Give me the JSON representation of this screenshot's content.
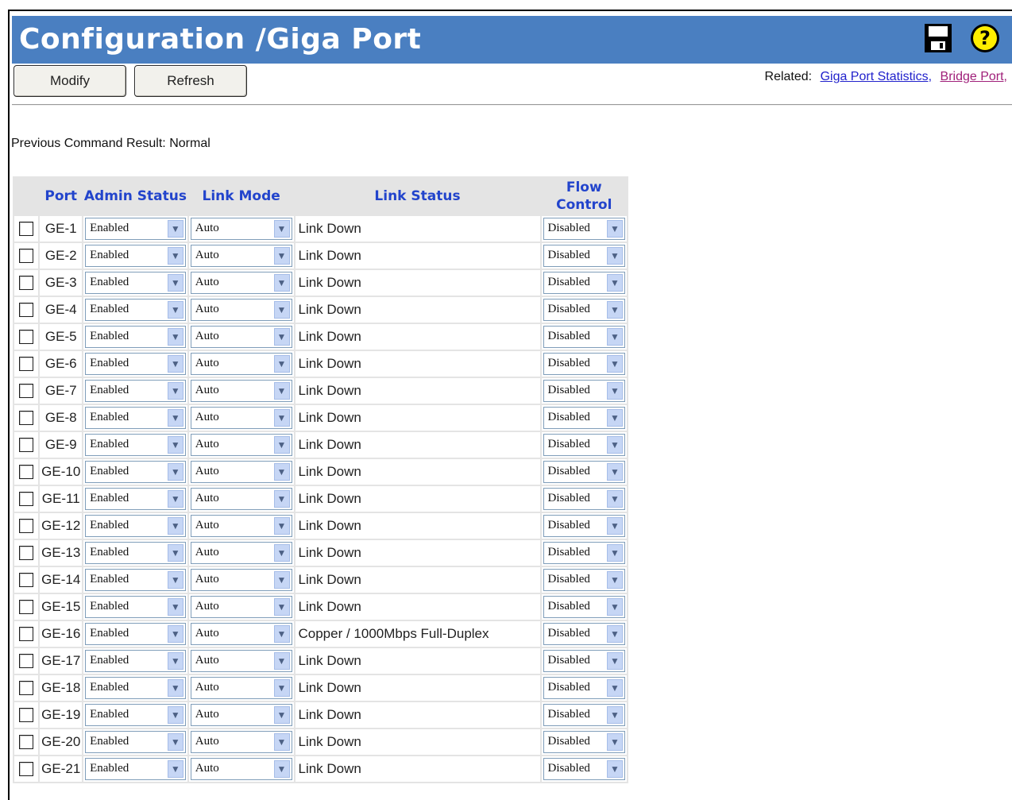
{
  "header": {
    "title": "Configuration /Giga Port",
    "save_icon": "floppy-save-icon",
    "help_icon": "help-question-icon",
    "help_glyph": "?"
  },
  "toolbar": {
    "modify_label": "Modify",
    "refresh_label": "Refresh"
  },
  "related": {
    "label": "Related:",
    "links": [
      "Giga Port Statistics,",
      "Bridge Port,"
    ]
  },
  "result": {
    "label": "Previous Command Result:",
    "value": "Normal"
  },
  "table": {
    "headers": {
      "port": "Port",
      "admin_status": "Admin Status",
      "link_mode": "Link Mode",
      "link_status": "Link Status",
      "flow_control": "Flow Control"
    },
    "rows": [
      {
        "port": "GE-1",
        "admin": "Enabled",
        "mode": "Auto",
        "status": "Link Down",
        "flow": "Disabled"
      },
      {
        "port": "GE-2",
        "admin": "Enabled",
        "mode": "Auto",
        "status": "Link Down",
        "flow": "Disabled"
      },
      {
        "port": "GE-3",
        "admin": "Enabled",
        "mode": "Auto",
        "status": "Link Down",
        "flow": "Disabled"
      },
      {
        "port": "GE-4",
        "admin": "Enabled",
        "mode": "Auto",
        "status": "Link Down",
        "flow": "Disabled"
      },
      {
        "port": "GE-5",
        "admin": "Enabled",
        "mode": "Auto",
        "status": "Link Down",
        "flow": "Disabled"
      },
      {
        "port": "GE-6",
        "admin": "Enabled",
        "mode": "Auto",
        "status": "Link Down",
        "flow": "Disabled"
      },
      {
        "port": "GE-7",
        "admin": "Enabled",
        "mode": "Auto",
        "status": "Link Down",
        "flow": "Disabled"
      },
      {
        "port": "GE-8",
        "admin": "Enabled",
        "mode": "Auto",
        "status": "Link Down",
        "flow": "Disabled"
      },
      {
        "port": "GE-9",
        "admin": "Enabled",
        "mode": "Auto",
        "status": "Link Down",
        "flow": "Disabled"
      },
      {
        "port": "GE-10",
        "admin": "Enabled",
        "mode": "Auto",
        "status": "Link Down",
        "flow": "Disabled"
      },
      {
        "port": "GE-11",
        "admin": "Enabled",
        "mode": "Auto",
        "status": "Link Down",
        "flow": "Disabled"
      },
      {
        "port": "GE-12",
        "admin": "Enabled",
        "mode": "Auto",
        "status": "Link Down",
        "flow": "Disabled"
      },
      {
        "port": "GE-13",
        "admin": "Enabled",
        "mode": "Auto",
        "status": "Link Down",
        "flow": "Disabled"
      },
      {
        "port": "GE-14",
        "admin": "Enabled",
        "mode": "Auto",
        "status": "Link Down",
        "flow": "Disabled"
      },
      {
        "port": "GE-15",
        "admin": "Enabled",
        "mode": "Auto",
        "status": "Link Down",
        "flow": "Disabled"
      },
      {
        "port": "GE-16",
        "admin": "Enabled",
        "mode": "Auto",
        "status": "Copper / 1000Mbps Full-Duplex",
        "flow": "Disabled"
      },
      {
        "port": "GE-17",
        "admin": "Enabled",
        "mode": "Auto",
        "status": "Link Down",
        "flow": "Disabled"
      },
      {
        "port": "GE-18",
        "admin": "Enabled",
        "mode": "Auto",
        "status": "Link Down",
        "flow": "Disabled"
      },
      {
        "port": "GE-19",
        "admin": "Enabled",
        "mode": "Auto",
        "status": "Link Down",
        "flow": "Disabled"
      },
      {
        "port": "GE-20",
        "admin": "Enabled",
        "mode": "Auto",
        "status": "Link Down",
        "flow": "Disabled"
      },
      {
        "port": "GE-21",
        "admin": "Enabled",
        "mode": "Auto",
        "status": "Link Down",
        "flow": "Disabled"
      }
    ]
  },
  "colors": {
    "title_bar": "#4a7fc1",
    "header_text": "#2244cc",
    "link_visited": "#a0207a",
    "link": "#2222cc"
  }
}
